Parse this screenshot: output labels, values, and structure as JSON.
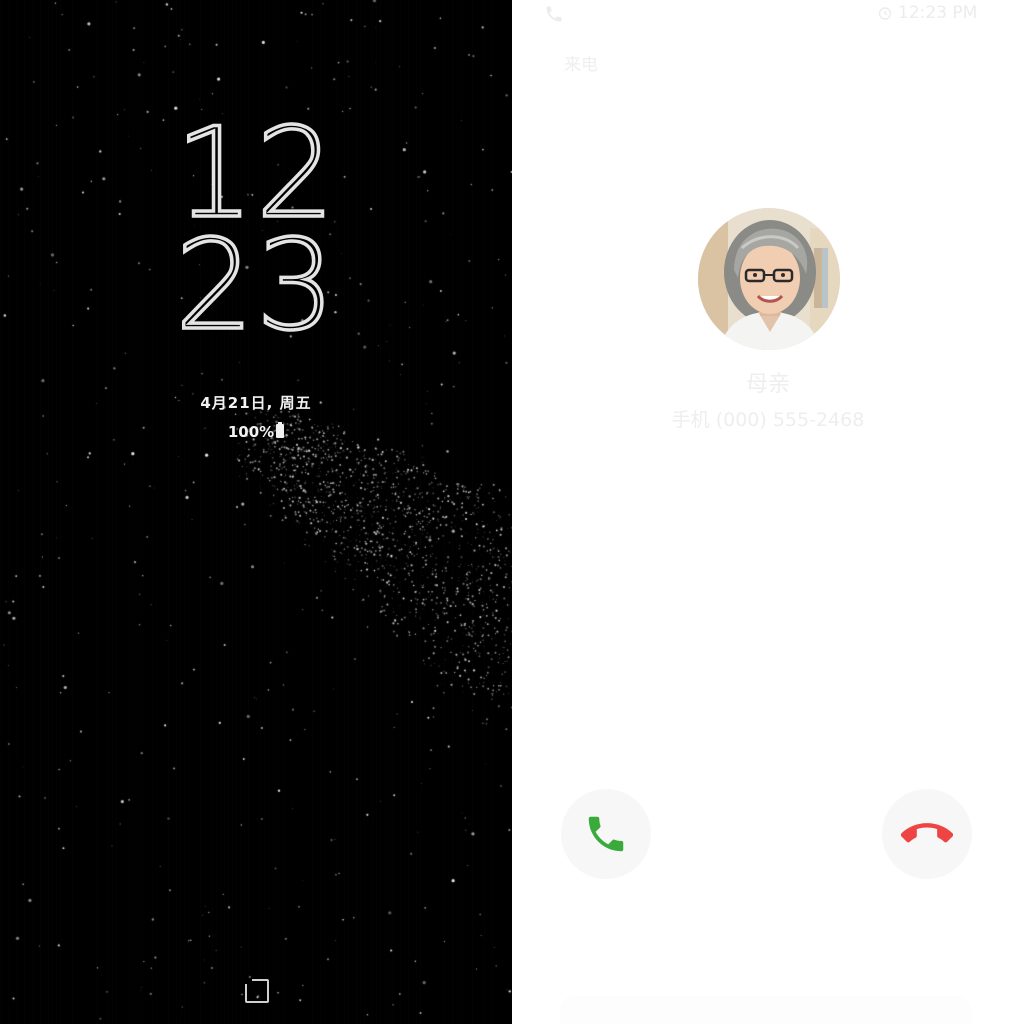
{
  "aod": {
    "clock_hour": "12",
    "clock_minute": "23",
    "date": "4月21日, 周五",
    "battery": "100%",
    "icons": {
      "battery": "battery-full-icon",
      "home": "home-key-icon"
    }
  },
  "call": {
    "status_bar": {
      "time": "12:23 PM",
      "icons": [
        "call-icon",
        "alarm-icon"
      ]
    },
    "header_label": "来电",
    "caller_name": "母亲",
    "caller_number": "手机 (000) 555-2468",
    "accept_icon": "phone-accept-icon",
    "decline_icon": "phone-decline-icon"
  },
  "colors": {
    "aod_background": "#000000",
    "call_background": "#ffffff",
    "accept_green": "#3aaa3a",
    "decline_red": "#ee4444"
  }
}
